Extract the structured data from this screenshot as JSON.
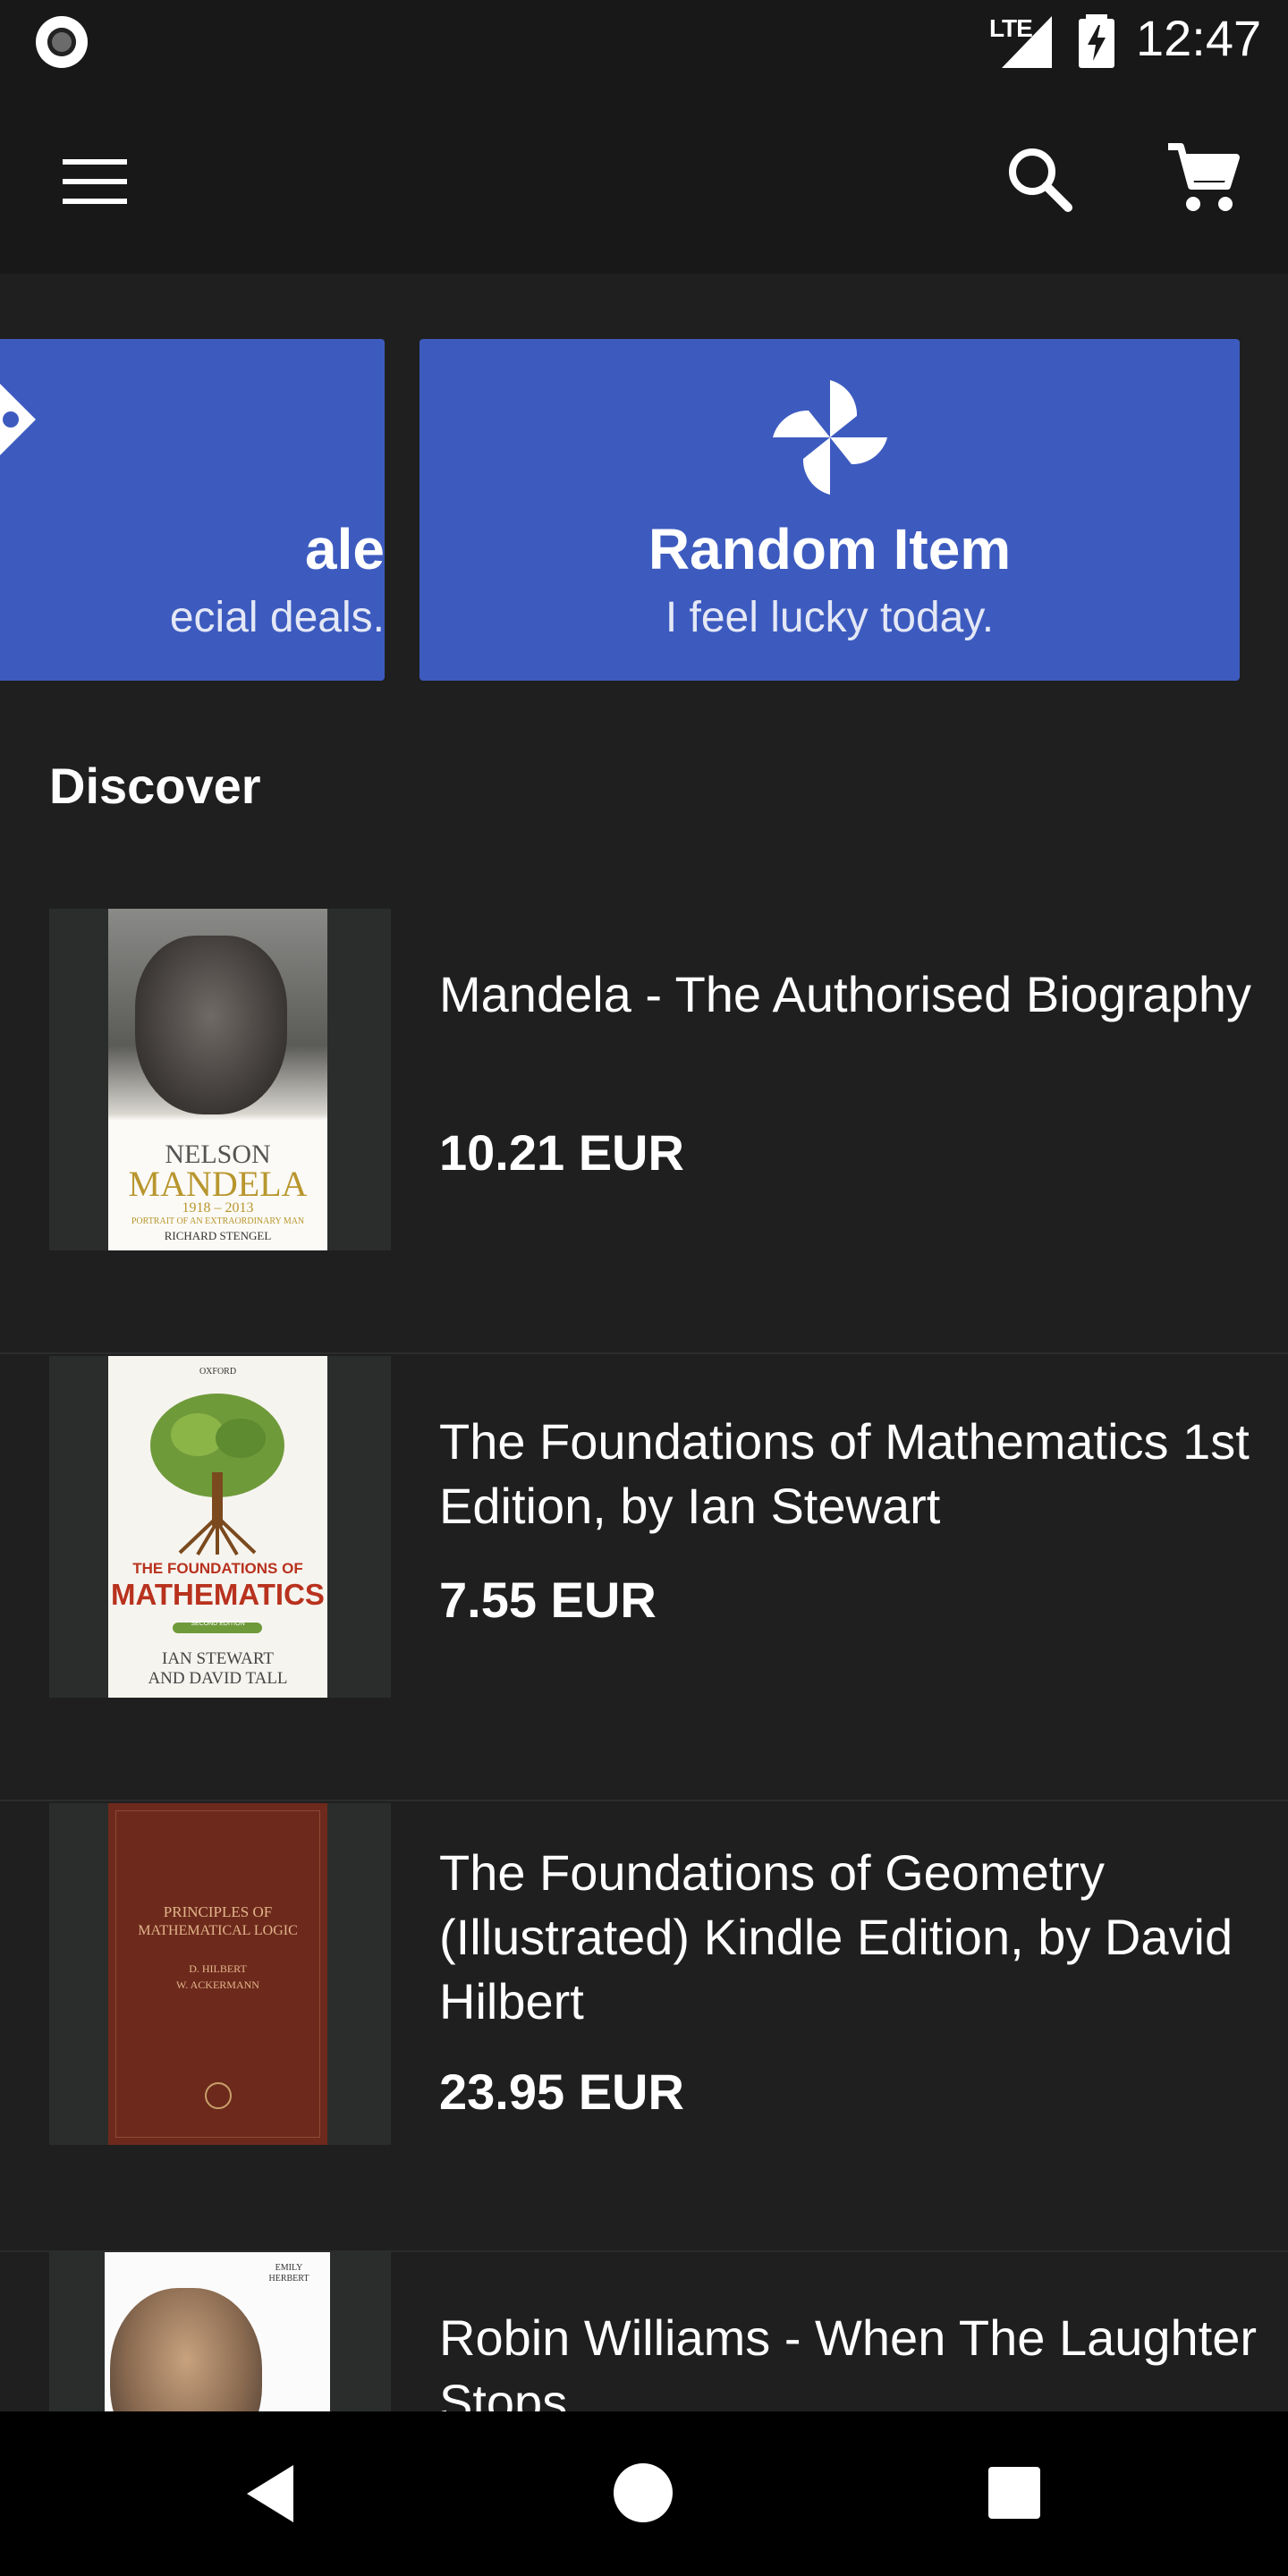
{
  "status_bar": {
    "network": "LTE",
    "time": "12:47"
  },
  "promos": [
    {
      "title": "ale",
      "subtitle": "ecial deals."
    },
    {
      "title": "Random Item",
      "subtitle": "I feel lucky today."
    }
  ],
  "section_title": "Discover",
  "items": [
    {
      "title": "Mandela - The Authorised Biography",
      "price": "10.21 EUR",
      "cover": {
        "line1": "NELSON",
        "line2": "MANDELA",
        "line3": "1918 – 2013",
        "line4": "PORTRAIT OF AN EXTRAORDINARY MAN",
        "line5": "RICHARD STENGEL"
      }
    },
    {
      "title": "The Foundations of Mathematics 1st Edition, by Ian Stewart",
      "price": "7.55 EUR",
      "cover": {
        "line0": "OXFORD",
        "line1": "THE FOUNDATIONS OF",
        "line2": "MATHEMATICS",
        "line3": "SECOND EDITION",
        "line4": "IAN STEWART",
        "line5": "AND DAVID TALL"
      }
    },
    {
      "title": "The Foundations of Geometry (Illustrated) Kindle Edition, by David Hilbert",
      "price": "23.95 EUR",
      "cover": {
        "line1": "PRINCIPLES OF",
        "line2": "MATHEMATICAL LOGIC",
        "line3": "D. HILBERT",
        "line4": "W. ACKERMANN"
      }
    },
    {
      "title": "Robin Williams - When The Laughter Stops",
      "price": "",
      "cover": {
        "line1": "EMILY",
        "line2": "HERBERT"
      }
    }
  ],
  "colors": {
    "promo_blue": "#3d5bbf",
    "background": "#1f1f1f",
    "bar": "#181818"
  },
  "icons": [
    "menu-icon",
    "search-icon",
    "cart-icon",
    "pinwheel-icon",
    "tag-icon",
    "back-icon",
    "home-icon",
    "recents-icon"
  ]
}
